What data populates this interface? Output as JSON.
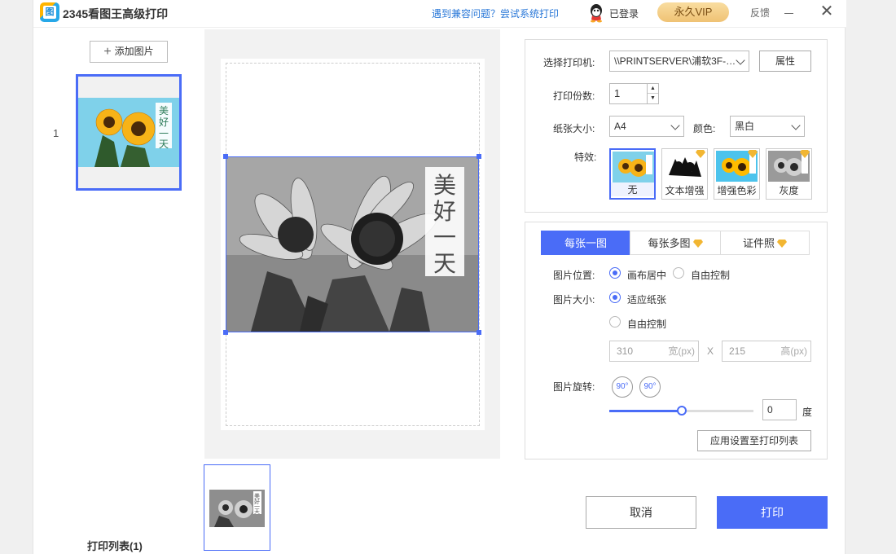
{
  "app": {
    "title": "2345看图王高级打印",
    "compat_link": "遇到兼容问题？尝试系统打印",
    "login_status": "已登录",
    "vip_label": "永久VIP",
    "feedback": "反馈",
    "icons": [
      "app-logo-icon",
      "user-icon",
      "minimize-icon",
      "close-icon"
    ]
  },
  "print_list": {
    "add_image": "添加图片",
    "items": [
      {
        "index": "1",
        "image_text": "美好一天"
      }
    ],
    "footer": "打印列表(1)"
  },
  "preview": {
    "image_text": [
      "美",
      "好",
      "一",
      "天"
    ]
  },
  "settings": {
    "printer_label": "选择打印机:",
    "printer_value": "\\\\PRINTSERVER\\浦软3F-…",
    "properties_btn": "属性",
    "copies_label": "打印份数:",
    "copies_value": "1",
    "paper_label": "纸张大小:",
    "paper_value": "A4",
    "color_label": "颜色:",
    "color_value": "黑白",
    "effects_label": "特效:",
    "effects": [
      {
        "label": "无",
        "selected": true,
        "vip": false
      },
      {
        "label": "文本增强",
        "selected": false,
        "vip": true
      },
      {
        "label": "增强色彩",
        "selected": false,
        "vip": true
      },
      {
        "label": "灰度",
        "selected": false,
        "vip": true
      }
    ]
  },
  "layout": {
    "tabs": [
      {
        "label": "每张一图",
        "active": true,
        "vip": false
      },
      {
        "label": "每张多图",
        "active": false,
        "vip": true
      },
      {
        "label": "证件照",
        "active": false,
        "vip": true
      }
    ],
    "position_label": "图片位置:",
    "position_options": [
      "画布居中",
      "自由控制"
    ],
    "position_selected": "画布居中",
    "size_label": "图片大小:",
    "size_options": [
      "适应纸张",
      "自由控制"
    ],
    "size_selected": "适应纸张",
    "width_value": "310",
    "width_unit": "宽(px)",
    "height_value": "215",
    "height_unit": "高(px)",
    "x_sep": "X",
    "rotate_label": "图片旋转:",
    "rotate_left": "90°",
    "rotate_right": "90°",
    "rotate_value": "0",
    "rotate_unit": "度",
    "rotate_slider_fraction": 0.5,
    "apply_btn": "应用设置至打印列表"
  },
  "actions": {
    "cancel": "取消",
    "print": "打印"
  },
  "colors": {
    "accent": "#4a6cf7",
    "vip_gold": "#efc274",
    "link": "#2a78d8"
  }
}
